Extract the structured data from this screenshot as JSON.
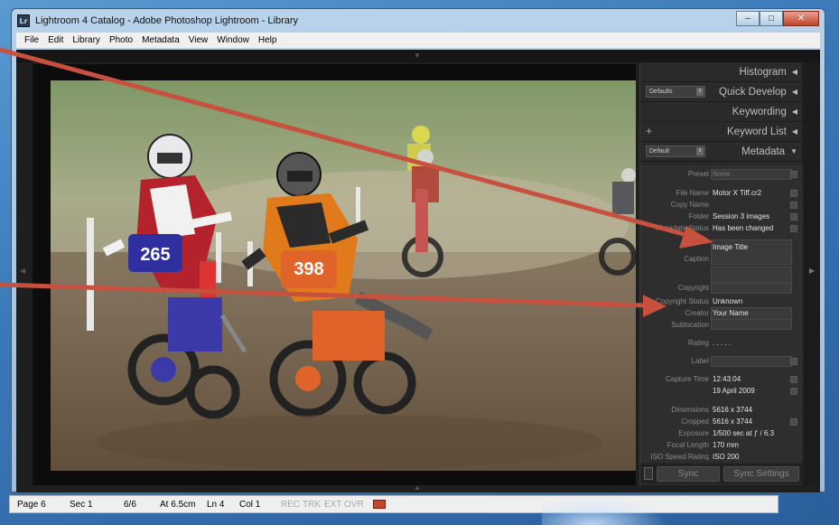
{
  "window": {
    "app_icon": "Lr",
    "title": "Lightroom 4 Catalog - Adobe Photoshop Lightroom - Library",
    "controls": {
      "minimize": "–",
      "maximize": "□",
      "close": "✕"
    }
  },
  "menu": [
    "File",
    "Edit",
    "Library",
    "Photo",
    "Metadata",
    "View",
    "Window",
    "Help"
  ],
  "panels": {
    "histogram": "Histogram",
    "quick_develop": "Quick Develop",
    "quick_develop_preset": "Defaults",
    "keywording": "Keywording",
    "keyword_list": "Keyword List",
    "keyword_add": "+",
    "metadata": "Metadata",
    "metadata_preset": "Default",
    "collapse_icon": "left-triangle-icon",
    "expand_icon": "down-triangle-icon"
  },
  "metadata": {
    "preset_label": "Preset",
    "preset_value": "None",
    "file_name_label": "File Name",
    "file_name": "Motor X Tiff.cr2",
    "copy_name_label": "Copy Name",
    "folder_label": "Folder",
    "folder": "Session 3 images",
    "metadata_status_label": "Metadata Status",
    "metadata_status": "Has been changed",
    "title_value": "Image Title",
    "caption_label": "Caption",
    "copyright_label": "Copyright",
    "copyright_status_label": "Copyright Status",
    "copyright_status": "Unknown",
    "creator_label": "Creator",
    "creator": "Your Name",
    "sublocation_label": "Sublocation",
    "rating_label": "Rating",
    "rating": ". . . . .",
    "label_label": "Label",
    "capture_time_label": "Capture Time",
    "capture_time": "12:43:04",
    "capture_date": "19 April 2009",
    "dimensions_label": "Dimensions",
    "dimensions": "5616 x 3744",
    "cropped_label": "Cropped",
    "cropped": "5616 x 3744",
    "exposure_label": "Exposure",
    "exposure": "1/500 sec at ƒ / 6.3",
    "focal_length_label": "Focal Length",
    "focal_length": "170 mm",
    "iso_label": "ISO Speed Rating",
    "iso": "ISO 200"
  },
  "sync": {
    "sync_label": "Sync",
    "sync_settings_label": "Sync Settings"
  },
  "photo": {
    "rider1_number": "265",
    "rider2_number": "398"
  },
  "statusbar": {
    "page": "Page 6",
    "sec": "Sec 1",
    "count": "6/6",
    "at": "At 6.5cm",
    "ln": "Ln 4",
    "col": "Col 1",
    "rec": "REC",
    "trk": "TRK",
    "ext": "EXT",
    "ovr": "OVR"
  },
  "colors": {
    "annotation_arrow": "#c8503f",
    "panel_bg": "#2a2a2a",
    "rider1_bike": "#3b3aa8",
    "rider2_bike": "#e0642a"
  }
}
